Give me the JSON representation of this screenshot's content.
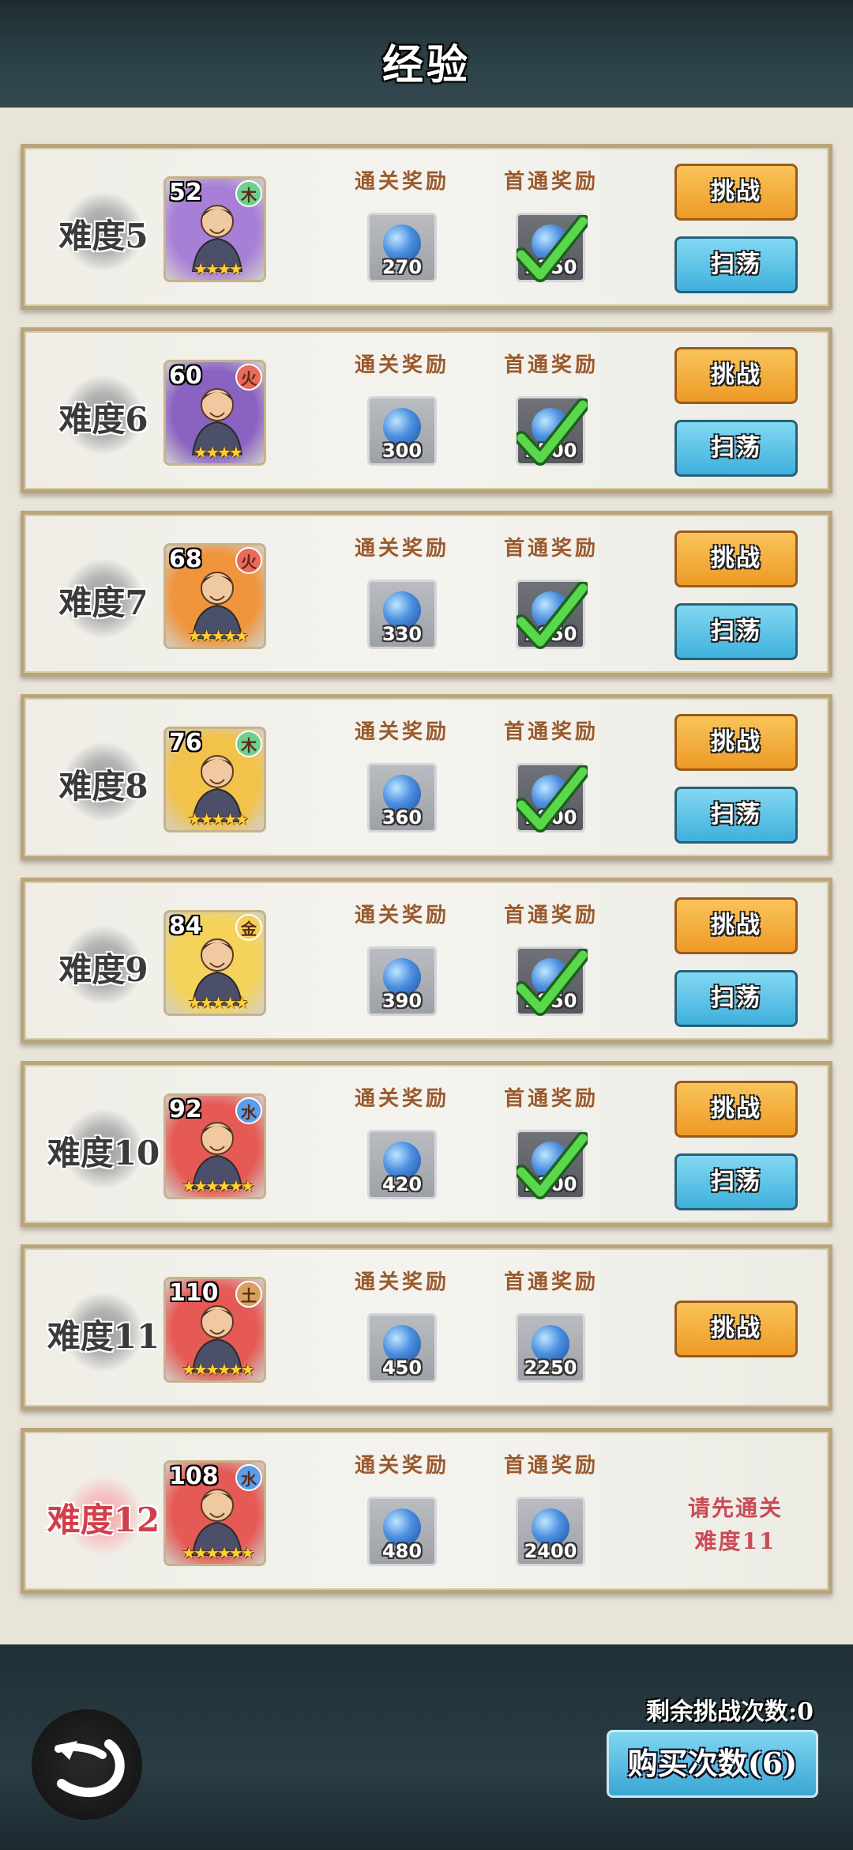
{
  "title": "经验",
  "labels": {
    "clear_reward": "通关奖励",
    "first_reward": "首通奖励"
  },
  "rows": [
    {
      "difficulty": "难度5",
      "level": "52",
      "element": "木",
      "element_color": "#6fcf8f",
      "stars": "★★★★",
      "bg": "#a77fd6",
      "clear": "270",
      "first": "1350",
      "first_claimed": true,
      "challenge": "挑战",
      "sweep": "扫荡",
      "locked": false
    },
    {
      "difficulty": "难度6",
      "level": "60",
      "element": "火",
      "element_color": "#ea6a5a",
      "stars": "★★★★",
      "bg": "#8a63c2",
      "clear": "300",
      "first": "1500",
      "first_claimed": true,
      "challenge": "挑战",
      "sweep": "扫荡",
      "locked": false
    },
    {
      "difficulty": "难度7",
      "level": "68",
      "element": "火",
      "element_color": "#ea6a5a",
      "stars": "★★★★★",
      "bg": "#f0953c",
      "clear": "330",
      "first": "1650",
      "first_claimed": true,
      "challenge": "挑战",
      "sweep": "扫荡",
      "locked": false
    },
    {
      "difficulty": "难度8",
      "level": "76",
      "element": "木",
      "element_color": "#6fcf8f",
      "stars": "★★★★★",
      "bg": "#f2c24a",
      "clear": "360",
      "first": "1800",
      "first_claimed": true,
      "challenge": "挑战",
      "sweep": "扫荡",
      "locked": false
    },
    {
      "difficulty": "难度9",
      "level": "84",
      "element": "金",
      "element_color": "#f2d15a",
      "stars": "★★★★★",
      "bg": "#f5d35a",
      "clear": "390",
      "first": "1950",
      "first_claimed": true,
      "challenge": "挑战",
      "sweep": "扫荡",
      "locked": false
    },
    {
      "difficulty": "难度10",
      "level": "92",
      "element": "水",
      "element_color": "#5a9de8",
      "stars": "★★★★★★",
      "bg": "#e65a55",
      "clear": "420",
      "first": "2100",
      "first_claimed": true,
      "challenge": "挑战",
      "sweep": "扫荡",
      "locked": false
    },
    {
      "difficulty": "难度11",
      "level": "110",
      "element": "土",
      "element_color": "#d8a060",
      "stars": "★★★★★★",
      "bg": "#e65a55",
      "clear": "450",
      "first": "2250",
      "first_claimed": false,
      "challenge": "挑战",
      "sweep": "",
      "locked": false
    },
    {
      "difficulty": "难度12",
      "level": "108",
      "element": "水",
      "element_color": "#5a9de8",
      "stars": "★★★★★★",
      "bg": "#e65a55",
      "clear": "480",
      "first": "2400",
      "first_claimed": false,
      "challenge": "",
      "sweep": "",
      "locked": true,
      "locked_note_1": "请先通关",
      "locked_note_2": "难度11"
    }
  ],
  "footer": {
    "remaining": "剩余挑战次数:0",
    "buy": "购买次数(6)"
  }
}
